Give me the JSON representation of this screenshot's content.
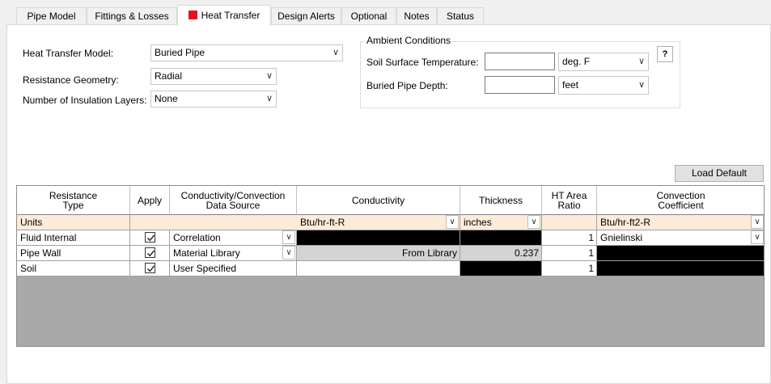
{
  "tabs": [
    {
      "label": "Pipe Model",
      "active": false
    },
    {
      "label": "Fittings & Losses",
      "active": false
    },
    {
      "label": "Heat Transfer",
      "active": true
    },
    {
      "label": "Design Alerts",
      "active": false
    },
    {
      "label": "Optional",
      "active": false
    },
    {
      "label": "Notes",
      "active": false
    },
    {
      "label": "Status",
      "active": false
    }
  ],
  "form": {
    "heat_transfer_model_label": "Heat Transfer Model:",
    "heat_transfer_model_value": "Buried Pipe",
    "resistance_geometry_label": "Resistance Geometry:",
    "resistance_geometry_value": "Radial",
    "insulation_layers_label": "Number of Insulation Layers:",
    "insulation_layers_value": "None"
  },
  "ambient": {
    "title": "Ambient Conditions",
    "soil_temp_label": "Soil Surface Temperature:",
    "soil_temp_value": "",
    "soil_temp_unit": "deg. F",
    "depth_label": "Buried Pipe Depth:",
    "depth_value": "",
    "depth_unit": "feet",
    "help_label": "?"
  },
  "load_default_label": "Load Default",
  "table": {
    "headers": {
      "resistance_type": "Resistance Type",
      "apply": "Apply",
      "source": "Conductivity/Convection Data Source",
      "conductivity": "Conductivity",
      "thickness": "Thickness",
      "ht_area": "HT Area Ratio",
      "convection": "Convection Coefficient"
    },
    "units": {
      "label": "Units",
      "conductivity": "Btu/hr-ft-R",
      "thickness": "inches",
      "convection": "Btu/hr-ft2-R"
    },
    "rows": [
      {
        "type": "Fluid Internal",
        "apply": true,
        "source": "Correlation",
        "conductivity": "",
        "thickness": "",
        "ht_area": "1",
        "convection": "Gnielinski"
      },
      {
        "type": "Pipe Wall",
        "apply": true,
        "source": "Material Library",
        "conductivity": "From Library",
        "thickness": "0.237",
        "ht_area": "1",
        "convection": ""
      },
      {
        "type": "Soil",
        "apply": true,
        "source": "User Specified",
        "conductivity": "",
        "thickness": "",
        "ht_area": "1",
        "convection": ""
      }
    ]
  },
  "colors": {
    "active_tab_marker": "#e81123",
    "units_row": "#fcebd9",
    "disabled_cell": "#000000",
    "grid_empty": "#a9a9a9"
  }
}
